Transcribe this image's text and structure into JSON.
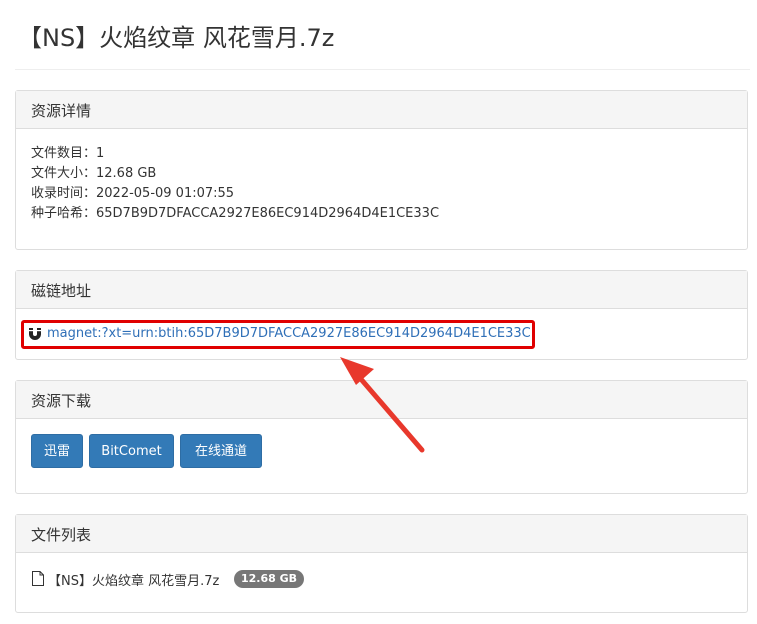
{
  "page": {
    "title": "【NS】火焰纹章 风花雪月.7z"
  },
  "details_panel": {
    "heading": "资源详情",
    "lines": [
      "文件数目：1",
      "文件大小：12.68 GB",
      "收录时间：2022-05-09 01:07:55",
      "种子哈希：65D7B9D7DFACCA2927E86EC914D2964D4E1CE33C"
    ]
  },
  "magnet_panel": {
    "heading": "磁链地址",
    "link": "magnet:?xt=urn:btih:65D7B9D7DFACCA2927E86EC914D2964D4E1CE33C",
    "icon": "magnet-icon",
    "highlight_color": "#e00000"
  },
  "download_panel": {
    "heading": "资源下载",
    "buttons": [
      "迅雷",
      "BitComet",
      "在线通道"
    ],
    "button_color": "#337ab7"
  },
  "files_panel": {
    "heading": "文件列表",
    "files": [
      {
        "name": "【NS】火焰纹章 风花雪月.7z",
        "size": "12.68 GB",
        "icon": "file-icon"
      }
    ]
  },
  "annotation": {
    "arrow_color": "#e8382c"
  }
}
